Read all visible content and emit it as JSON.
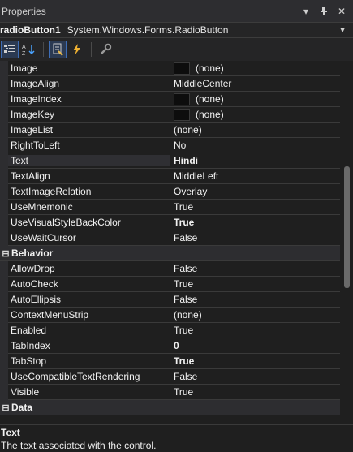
{
  "window": {
    "title": "Properties"
  },
  "object_selector": {
    "name": "radioButton1",
    "type": "System.Windows.Forms.RadioButton"
  },
  "toolbar": {
    "buttons": [
      "categorized-icon",
      "alphabetical-icon",
      "properties-icon",
      "events-icon",
      "property-pages-icon"
    ]
  },
  "rows_top": [
    {
      "name": "Image",
      "value": "(none)",
      "swatch": true
    },
    {
      "name": "ImageAlign",
      "value": "MiddleCenter"
    },
    {
      "name": "ImageIndex",
      "value": "(none)",
      "swatch": true
    },
    {
      "name": "ImageKey",
      "value": "(none)",
      "swatch": true
    },
    {
      "name": "ImageList",
      "value": "(none)"
    },
    {
      "name": "RightToLeft",
      "value": "No"
    },
    {
      "name": "Text",
      "value": "Hindi",
      "bold": true,
      "selected": true
    },
    {
      "name": "TextAlign",
      "value": "MiddleLeft"
    },
    {
      "name": "TextImageRelation",
      "value": "Overlay"
    },
    {
      "name": "UseMnemonic",
      "value": "True"
    },
    {
      "name": "UseVisualStyleBackColor",
      "value": "True",
      "bold": true
    },
    {
      "name": "UseWaitCursor",
      "value": "False"
    }
  ],
  "category_behavior": {
    "label": "Behavior"
  },
  "rows_behavior": [
    {
      "name": "AllowDrop",
      "value": "False"
    },
    {
      "name": "AutoCheck",
      "value": "True"
    },
    {
      "name": "AutoEllipsis",
      "value": "False"
    },
    {
      "name": "ContextMenuStrip",
      "value": "(none)"
    },
    {
      "name": "Enabled",
      "value": "True"
    },
    {
      "name": "TabIndex",
      "value": "0",
      "bold": true
    },
    {
      "name": "TabStop",
      "value": "True",
      "bold": true
    },
    {
      "name": "UseCompatibleTextRendering",
      "value": "False"
    },
    {
      "name": "Visible",
      "value": "True"
    }
  ],
  "category_data": {
    "label": "Data"
  },
  "description": {
    "title": "Text",
    "text": "The text associated with the control."
  }
}
